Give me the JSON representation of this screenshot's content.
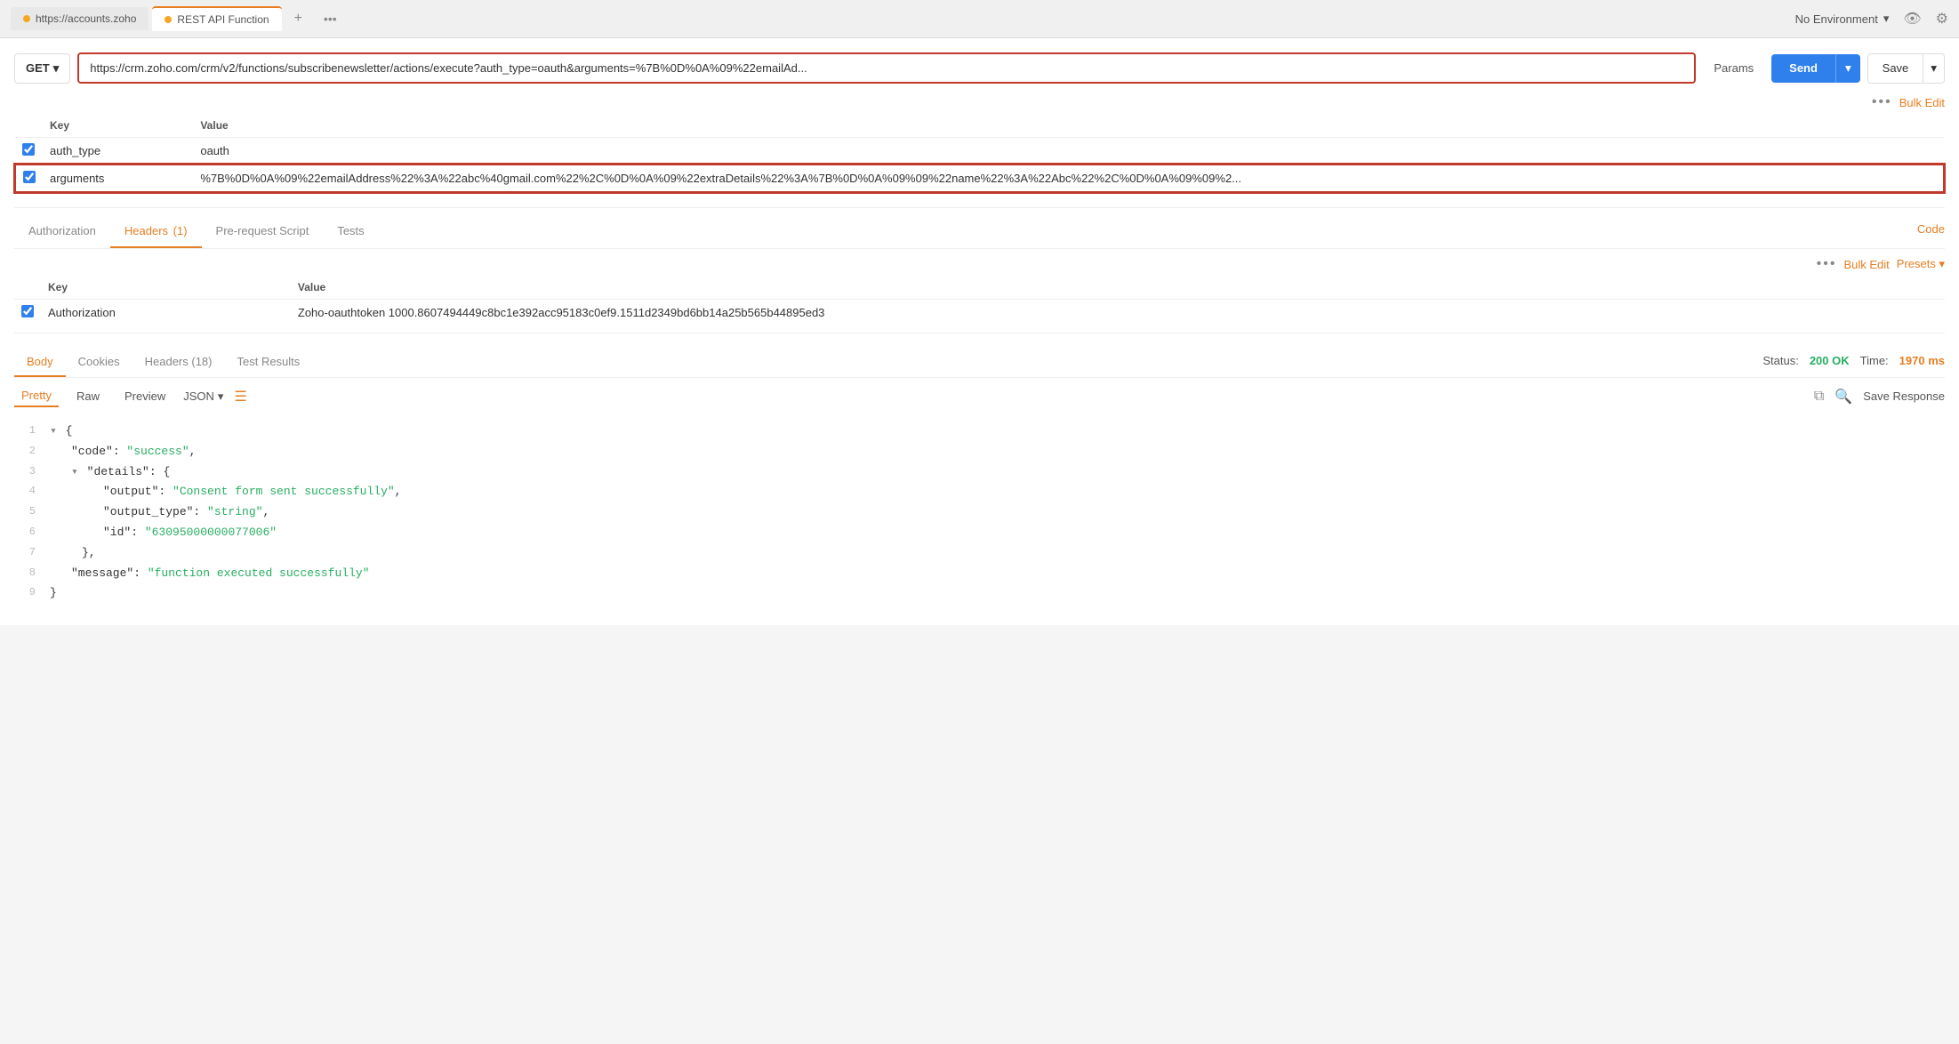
{
  "tabs": {
    "items": [
      {
        "label": "https://accounts.zoho",
        "dot": "orange",
        "active": false
      },
      {
        "label": "REST API Function",
        "dot": "orange",
        "active": true
      }
    ],
    "add_label": "+",
    "more_label": "•••"
  },
  "env": {
    "label": "No Environment",
    "chevron": "▾"
  },
  "toolbar": {
    "eye_icon": "👁",
    "gear_icon": "⚙"
  },
  "request": {
    "method": "GET",
    "url": "https://crm.zoho.com/crm/v2/functions/subscribenewsletter/actions/execute?auth_type=oauth&arguments=%7B%0D%0A%09%22emailAd...",
    "params_label": "Params",
    "send_label": "Send",
    "save_label": "Save"
  },
  "query_params": {
    "headers": [
      "Key",
      "Value"
    ],
    "rows": [
      {
        "checked": true,
        "key": "auth_type",
        "value": "oauth"
      },
      {
        "checked": true,
        "key": "arguments",
        "value": "%7B%0D%0A%09%22emailAddress%22%3A%22abc%40gmail.com%22%2C%0D%0A%09%22extraDetails%22%3A%7B%0D%0A%09%09%22name%22%3A%22Abc%22%2C%0D%0A%09%09%2..."
      }
    ],
    "bulk_edit_label": "Bulk Edit"
  },
  "request_tabs": {
    "items": [
      {
        "label": "Authorization",
        "active": false,
        "badge": ""
      },
      {
        "label": "Headers",
        "active": true,
        "badge": "(1)"
      },
      {
        "label": "Pre-request Script",
        "active": false,
        "badge": ""
      },
      {
        "label": "Tests",
        "active": false,
        "badge": ""
      }
    ],
    "code_label": "Code"
  },
  "headers_section": {
    "headers": [
      "Key",
      "Value"
    ],
    "rows": [
      {
        "checked": true,
        "key": "Authorization",
        "value": "Zoho-oauthtoken 1000.8607494449c8bc1e392acc95183c0ef9.1511d2349bd6bb14a25b565b44895ed3"
      }
    ],
    "bulk_edit_label": "Bulk Edit",
    "presets_label": "Presets ▾"
  },
  "response": {
    "tabs": [
      {
        "label": "Body",
        "active": true
      },
      {
        "label": "Cookies",
        "active": false
      },
      {
        "label": "Headers (18)",
        "active": false
      },
      {
        "label": "Test Results",
        "active": false
      }
    ],
    "status_label": "Status:",
    "status_value": "200 OK",
    "time_label": "Time:",
    "time_value": "1970 ms",
    "format_tabs": [
      {
        "label": "Pretty",
        "active": true
      },
      {
        "label": "Raw",
        "active": false
      },
      {
        "label": "Preview",
        "active": false
      }
    ],
    "format_select": "JSON",
    "save_response_label": "Save Response",
    "json_lines": [
      {
        "num": "1",
        "content": "{",
        "type": "bracket",
        "indent": 0,
        "collapse": "▾"
      },
      {
        "num": "2",
        "content": "\"code\": \"success\",",
        "type": "keystring",
        "indent": 1,
        "key": "code",
        "value": "success"
      },
      {
        "num": "3",
        "content": "\"details\": {",
        "type": "keyobject",
        "indent": 1,
        "key": "details",
        "collapse": "▾"
      },
      {
        "num": "4",
        "content": "\"output\": \"Consent form sent successfully\",",
        "type": "keystring",
        "indent": 2,
        "key": "output",
        "value": "Consent form sent successfully"
      },
      {
        "num": "5",
        "content": "\"output_type\": \"string\",",
        "type": "keystring",
        "indent": 2,
        "key": "output_type",
        "value": "string"
      },
      {
        "num": "6",
        "content": "\"id\": \"63095000000077006\"",
        "type": "keystring",
        "indent": 2,
        "key": "id",
        "value": "63095000000077006"
      },
      {
        "num": "7",
        "content": "},",
        "type": "bracket",
        "indent": 1
      },
      {
        "num": "8",
        "content": "\"message\": \"function executed successfully\"",
        "type": "keystring",
        "indent": 1,
        "key": "message",
        "value": "function executed successfully"
      },
      {
        "num": "9",
        "content": "}",
        "type": "bracket",
        "indent": 0
      }
    ]
  }
}
